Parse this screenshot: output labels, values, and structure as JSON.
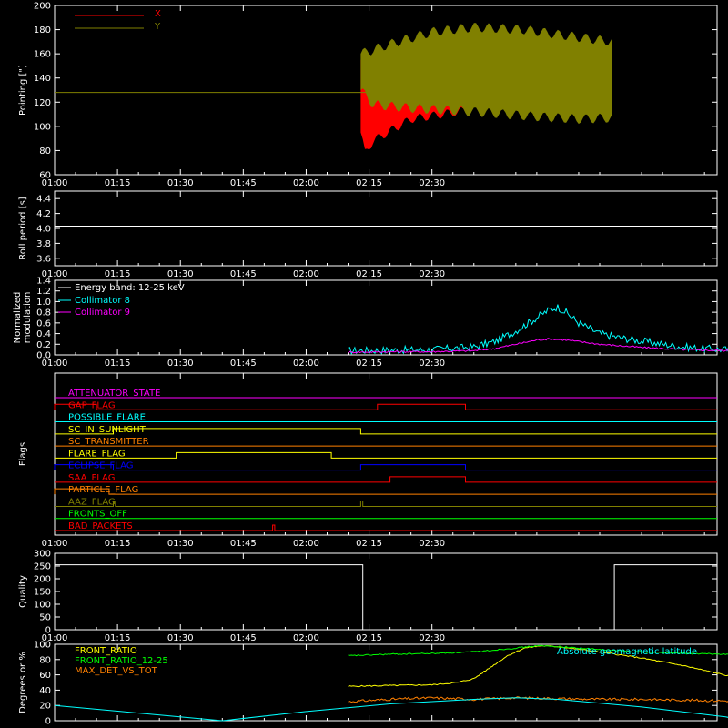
{
  "colors": {
    "background": "#000000",
    "axis": "#ffffff",
    "x_pointing": "#ff0000",
    "y_pointing": "#808000",
    "white": "#ffffff",
    "cyan": "#00ffff",
    "magenta": "#ff00ff",
    "yellow": "#ffff00",
    "orange": "#ff8000",
    "blue": "#0000ff",
    "green": "#00ff00",
    "red": "#ff0000"
  },
  "time_ticks": [
    "01:00",
    "01:15",
    "01:30",
    "01:45",
    "02:00",
    "02:15",
    "02:30"
  ],
  "chart_data": [
    {
      "type": "line",
      "ylabel": "Pointing [\"]",
      "ylim": [
        60,
        200
      ],
      "yticks": [
        "60",
        "80",
        "100",
        "120",
        "140",
        "160",
        "180",
        "200"
      ],
      "legend": [
        {
          "label": "X",
          "color": "#ff0000"
        },
        {
          "label": "Y",
          "color": "#808000"
        }
      ],
      "legend_placement": "top-left",
      "data_span": [
        "01:13",
        "02:13"
      ],
      "series": [
        {
          "name": "X",
          "color": "#ff0000",
          "envelope_upper": [
            [
              73,
              155
            ],
            [
              76,
              150
            ],
            [
              85,
              160
            ],
            [
              100,
              162
            ],
            [
              115,
              162
            ],
            [
              125,
              160
            ],
            [
              133,
              158
            ]
          ],
          "envelope_lower": [
            [
              73,
              95
            ],
            [
              74,
              78
            ],
            [
              76,
              88
            ],
            [
              85,
              106
            ],
            [
              100,
              114
            ],
            [
              115,
              117
            ],
            [
              125,
              115
            ],
            [
              133,
              116
            ]
          ]
        },
        {
          "name": "Y",
          "color": "#808000",
          "envelope_upper": [
            [
              73,
              160
            ],
            [
              80,
              168
            ],
            [
              90,
              178
            ],
            [
              100,
              182
            ],
            [
              112,
              180
            ],
            [
              120,
              176
            ],
            [
              133,
              170
            ]
          ],
          "envelope_lower": [
            [
              73,
              130
            ],
            [
              76,
              118
            ],
            [
              85,
              115
            ],
            [
              100,
              112
            ],
            [
              115,
              108
            ],
            [
              125,
              106
            ],
            [
              133,
              107
            ]
          ]
        }
      ],
      "reference_line": {
        "y": 128,
        "x_range": [
          "01:00",
          "02:38"
        ],
        "color": "#808000"
      }
    },
    {
      "type": "line",
      "ylabel": "Roll period [s]",
      "ylim": [
        3.5,
        4.5
      ],
      "yticks": [
        "3.6",
        "3.8",
        "4.0",
        "4.2",
        "4.4"
      ],
      "series": [
        {
          "color": "#ffffff",
          "points": [
            [
              0,
              4.03
            ],
            [
              158,
              4.03
            ]
          ]
        }
      ]
    },
    {
      "type": "line",
      "ylabel": "Normalized modulation",
      "ylim": [
        0,
        1.4
      ],
      "yticks": [
        "0.0",
        "0.2",
        "0.4",
        "0.6",
        "0.8",
        "1.0",
        "1.2",
        "1.4"
      ],
      "legend_title": "Energy band: 12-25 keV",
      "legend_placement": "top-left",
      "data_span": [
        "01:10",
        "02:17"
      ],
      "series": [
        {
          "name": "Collimator 8",
          "color": "#00ffff",
          "points": [
            [
              70,
              0.08
            ],
            [
              80,
              0.09
            ],
            [
              90,
              0.1
            ],
            [
              100,
              0.15
            ],
            [
              105,
              0.25
            ],
            [
              110,
              0.45
            ],
            [
              115,
              0.7
            ],
            [
              118,
              0.85
            ],
            [
              120,
              0.9
            ],
            [
              122,
              0.8
            ],
            [
              125,
              0.6
            ],
            [
              130,
              0.4
            ],
            [
              135,
              0.32
            ],
            [
              140,
              0.26
            ],
            [
              145,
              0.2
            ],
            [
              150,
              0.15
            ],
            [
              155,
              0.12
            ],
            [
              160,
              0.1
            ],
            [
              165,
              0.1
            ],
            [
              167,
              0.1
            ]
          ]
        },
        {
          "name": "Collimator 9",
          "color": "#ff00ff",
          "points": [
            [
              70,
              0.05
            ],
            [
              80,
              0.06
            ],
            [
              90,
              0.06
            ],
            [
              100,
              0.08
            ],
            [
              105,
              0.12
            ],
            [
              110,
              0.2
            ],
            [
              115,
              0.28
            ],
            [
              118,
              0.3
            ],
            [
              122,
              0.28
            ],
            [
              130,
              0.2
            ],
            [
              140,
              0.14
            ],
            [
              150,
              0.1
            ],
            [
              160,
              0.08
            ],
            [
              167,
              0.07
            ]
          ]
        }
      ]
    },
    {
      "type": "line",
      "ylabel": "Flags",
      "flags": [
        {
          "name": "ATTENUATOR_STATE",
          "color": "#ff00ff",
          "on_intervals": []
        },
        {
          "name": "GAP_FLAG",
          "color": "#ff0000",
          "on_intervals": [
            [
              "01:00",
              "01:10"
            ],
            [
              "02:17",
              "02:38"
            ]
          ]
        },
        {
          "name": "POSSIBLE_FLARE",
          "color": "#00ffff",
          "on_intervals": []
        },
        {
          "name": "SC_IN_SUNLIGHT",
          "color": "#ffff00",
          "on_intervals": [
            [
              "01:14",
              "02:13"
            ]
          ]
        },
        {
          "name": "SC_TRANSMITTER",
          "color": "#ff8000",
          "on_intervals": []
        },
        {
          "name": "FLARE_FLAG",
          "color": "#ffff00",
          "on_intervals": [
            [
              "01:29",
              "02:06"
            ]
          ]
        },
        {
          "name": "ECLIPSE_FLAG",
          "color": "#0000ff",
          "on_intervals": [
            [
              "01:00",
              "01:14"
            ],
            [
              "02:13",
              "02:38"
            ]
          ]
        },
        {
          "name": "SAA_FLAG",
          "color": "#ff0000",
          "on_intervals": [
            [
              "02:20",
              "02:38"
            ]
          ]
        },
        {
          "name": "PARTICLE_FLAG",
          "color": "#ff8000",
          "on_intervals": [
            [
              "01:00",
              "01:13"
            ]
          ]
        },
        {
          "name": "AAZ_FLAG",
          "color": "#808000",
          "on_intervals": [
            [
              "01:14",
              "01:14"
            ],
            [
              "02:13",
              "02:13"
            ]
          ]
        },
        {
          "name": "FRONTS_OFF",
          "color": "#00ff00",
          "on_intervals": []
        },
        {
          "name": "BAD_PACKETS",
          "color": "#ff0000",
          "on_intervals": [
            [
              "01:52",
              "01:52"
            ]
          ]
        }
      ]
    },
    {
      "type": "line",
      "ylabel": "Quality",
      "ylim": [
        0,
        300
      ],
      "yticks": [
        "0",
        "50",
        "100",
        "150",
        "200",
        "250",
        "300"
      ],
      "series": [
        {
          "color": "#ffffff",
          "points": [
            [
              0,
              255
            ],
            [
              73.5,
              255
            ],
            [
              73.5,
              0
            ],
            [
              133.5,
              0
            ],
            [
              133.5,
              255
            ],
            [
              158,
              255
            ]
          ]
        }
      ]
    },
    {
      "type": "line",
      "ylabel": "Degrees or %",
      "ylim": [
        0,
        100
      ],
      "yticks": [
        "0",
        "20",
        "40",
        "60",
        "80",
        "100"
      ],
      "legend_placement": "top-left",
      "data_span": [
        "01:10",
        "02:17"
      ],
      "series": [
        {
          "name": "FRONT_RATIO",
          "color": "#ffff00",
          "points": [
            [
              70,
              45
            ],
            [
              90,
              47
            ],
            [
              96,
              50
            ],
            [
              100,
              55
            ],
            [
              104,
              70
            ],
            [
              108,
              85
            ],
            [
              112,
              95
            ],
            [
              116,
              98
            ],
            [
              120,
              97
            ],
            [
              130,
              90
            ],
            [
              140,
              82
            ],
            [
              150,
              72
            ],
            [
              158,
              62
            ],
            [
              163,
              56
            ],
            [
              167,
              55
            ]
          ]
        },
        {
          "name": "FRONT_RATIO_12-25",
          "color": "#00ff00",
          "points": [
            [
              70,
              85
            ],
            [
              80,
              87
            ],
            [
              90,
              88
            ],
            [
              100,
              90
            ],
            [
              110,
              95
            ],
            [
              115,
              98
            ],
            [
              120,
              97
            ],
            [
              130,
              93
            ],
            [
              140,
              90
            ],
            [
              150,
              88
            ],
            [
              160,
              87
            ],
            [
              167,
              86
            ]
          ]
        },
        {
          "name": "MAX_DET_VS_TOT",
          "color": "#ff8000",
          "points": [
            [
              70,
              25
            ],
            [
              80,
              28
            ],
            [
              90,
              30
            ],
            [
              100,
              28
            ],
            [
              110,
              30
            ],
            [
              120,
              29
            ],
            [
              130,
              28
            ],
            [
              140,
              28
            ],
            [
              150,
              27
            ],
            [
              160,
              26
            ],
            [
              167,
              26
            ]
          ]
        },
        {
          "name": "Absolute geomagnetic latitude",
          "color": "#00ffff",
          "points": [
            [
              0,
              20
            ],
            [
              20,
              10
            ],
            [
              40,
              0
            ],
            [
              60,
              12
            ],
            [
              80,
              22
            ],
            [
              100,
              28
            ],
            [
              110,
              30
            ],
            [
              120,
              28
            ],
            [
              140,
              18
            ],
            [
              160,
              5
            ],
            [
              165,
              0
            ],
            [
              180,
              12
            ],
            [
              200,
              25
            ],
            [
              220,
              30
            ],
            [
              238,
              22
            ]
          ]
        }
      ]
    }
  ]
}
